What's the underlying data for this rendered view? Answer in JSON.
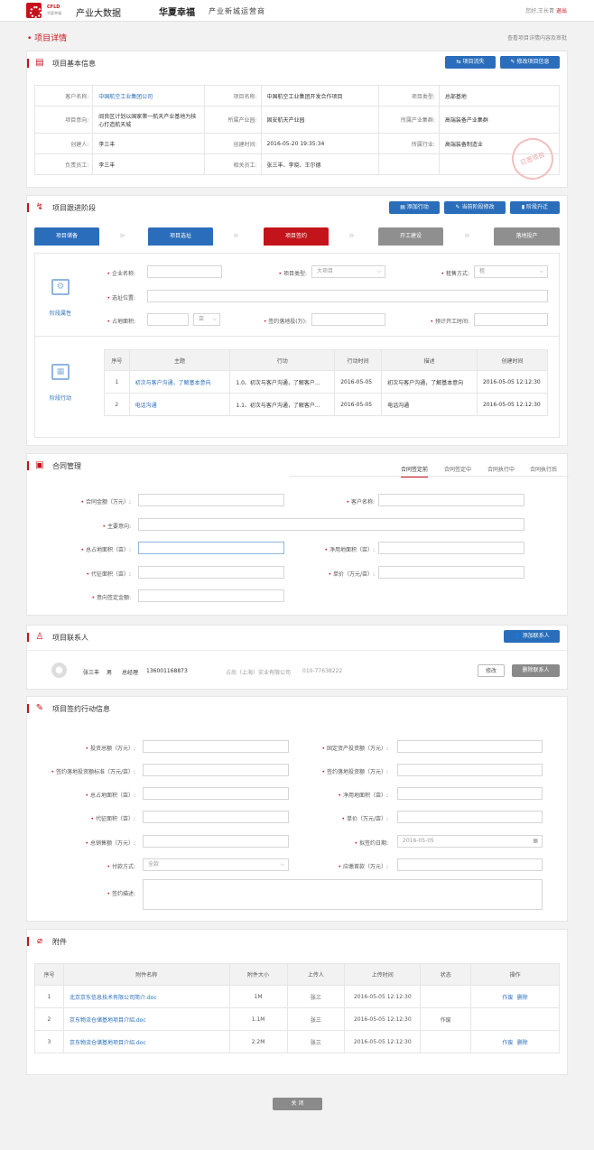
{
  "header": {
    "logo_main": "CFLD",
    "logo_sub": "华夏幸福",
    "app": "产业大数据",
    "brand": "华夏幸福",
    "brand_sub": "产业新城运营商",
    "greeting": "您好,王长青",
    "logout": "退出"
  },
  "page": {
    "crumb": "• 项目详情",
    "hint": "查看项目详情内容及审批"
  },
  "basic": {
    "title": "项目基本信息",
    "btn_flow": "项目流失",
    "btn_edit": "修改项目信息",
    "rows": [
      [
        "客户名称:",
        "中国航空工业集团公司",
        "项目名称:",
        "中国航空工业集团开发合作项目",
        "项目类型:",
        "总部基地"
      ],
      [
        "项目意向:",
        "阎良区计划以国家第一航天产业基地为核心打造航天城",
        "所属产业园:",
        "固安航天产业园",
        "所属产业集群:",
        "高端装备产业集群"
      ],
      [
        "创建人:",
        "李三丰",
        "创建时间:",
        "2016-05-20   19:35:34",
        "所属行业:",
        "高端装备制造业"
      ],
      [
        "负责员工:",
        "李三丰",
        "相关员工:",
        "张三丰、李晓、王尔德",
        "",
        ""
      ]
    ],
    "stamp": "已签项目"
  },
  "track": {
    "title": "项目跟进阶段",
    "btn_add": "添加行动",
    "btn_modify": "当前阶段修改",
    "btn_up": "阶段升迁",
    "steps": [
      "项目储备",
      "项目选址",
      "项目签约",
      "开工建设",
      "落地投产"
    ],
    "attr_label": "阶段属性",
    "action_label": "阶段行动",
    "f_company": "企业名称:",
    "f_type": "项目类型:",
    "f_type_val": "大项目",
    "f_rent": "租售方式:",
    "f_rent_val": "租",
    "f_site": "选址位置:",
    "f_area": "占地面积:",
    "f_unit": "亩",
    "f_invest": "签约落地投(万):",
    "f_start": "预计开工时间:",
    "cols": [
      "序号",
      "主题",
      "行动",
      "行动时间",
      "描述",
      "创建时间"
    ],
    "rows": [
      [
        "1",
        "初次与客户沟通，了解基本意向",
        "1.0、初次与客户沟通，了解客户...",
        "2016-05-05",
        "初次与客户沟通，了解基本意向",
        "2016-05-05  12:12:30"
      ],
      [
        "2",
        "电话沟通",
        "1.1、初次与客户沟通，了解客户...",
        "2016-05-05",
        "电话沟通",
        "2016-05-05  12:12:30"
      ]
    ]
  },
  "contract": {
    "title": "合同管理",
    "tabs": [
      "合同签定前",
      "合同签定中",
      "合同执行中",
      "合同执行后"
    ],
    "f1": "合同金额（万元）:",
    "f2": "客户名称:",
    "f3": "主要意向:",
    "f4": "总占地面积（亩）:",
    "f5": "净用地面积（亩）:",
    "f6": "代征面积（亩）:",
    "f7": "单价（万元/亩）:",
    "f8": "意向签定金额:"
  },
  "contact": {
    "title": "项目联系人",
    "btn_add": "添加联系人",
    "name": "张三丰",
    "sex": "男",
    "role": "总经理",
    "phone": "136001168873",
    "company": "占尚（上海）实业有限公司",
    "tel": "010-77638222",
    "btn_edit": "修改",
    "btn_del": "删除联系人"
  },
  "sign": {
    "title": "项目签约行动信息",
    "l1": "投资总额（万元）:",
    "r1": "固定资产投资额（万元）:",
    "l2": "签约落地投资额标准（万元/亩）:",
    "r2": "签约落地投资额（万元）:",
    "l3": "总占地面积（亩）:",
    "r3": "净用地面积（亩）:",
    "l4": "代征面积（亩）:",
    "r4": "单价（万元/亩）:",
    "l5": "总销售额（万元）:",
    "r5": "拟签约日期:",
    "r5_val": "2016-05-05",
    "l6": "付款方式:",
    "l6_val": "全款",
    "r6": "应缴首款（万元）:",
    "l7": "签约描述:"
  },
  "attach": {
    "title": "附件",
    "cols": [
      "序号",
      "附件名称",
      "附件大小",
      "上传人",
      "上传时间",
      "状态",
      "操作"
    ],
    "rows": [
      [
        "1",
        "北京京东信息技术有限公司简介.doc",
        "1M",
        "张三",
        "2016-05-05  12:12:30",
        "",
        [
          "作废",
          "删除"
        ]
      ],
      [
        "2",
        "京东物流仓储基地项目介绍.doc",
        "1.1M",
        "张三",
        "2016-05-05  12:12:30",
        "作废",
        []
      ],
      [
        "3",
        "京东物流仓储基地项目介绍.doc",
        "2.2M",
        "张三",
        "2016-05-05  12:12:30",
        "",
        [
          "作废",
          "删除"
        ]
      ]
    ]
  },
  "footer": {
    "close": "关 闭"
  },
  "colors": {
    "accent": "#c4141b",
    "primary": "#2a6ebb"
  }
}
